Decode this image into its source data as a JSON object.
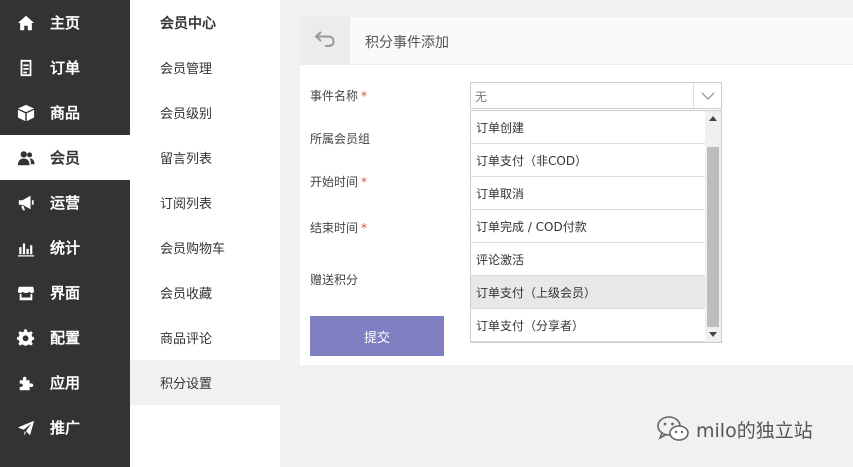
{
  "nav": {
    "items": [
      {
        "label": "主页",
        "icon": "home-icon"
      },
      {
        "label": "订单",
        "icon": "order-document-icon"
      },
      {
        "label": "商品",
        "icon": "box-icon"
      },
      {
        "label": "会员",
        "icon": "users-icon"
      },
      {
        "label": "运营",
        "icon": "megaphone-icon"
      },
      {
        "label": "统计",
        "icon": "bar-chart-icon"
      },
      {
        "label": "界面",
        "icon": "storefront-icon"
      },
      {
        "label": "配置",
        "icon": "gear-icon"
      },
      {
        "label": "应用",
        "icon": "puzzle-icon"
      },
      {
        "label": "推广",
        "icon": "paper-plane-icon"
      }
    ],
    "active_index": 3
  },
  "subnav": {
    "title": "会员中心",
    "items": [
      "会员管理",
      "会员级别",
      "留言列表",
      "订阅列表",
      "会员购物车",
      "会员收藏",
      "商品评论",
      "积分设置"
    ],
    "active_index": 7
  },
  "panel": {
    "title": "积分事件添加",
    "back_icon": "back-arrow-icon"
  },
  "form": {
    "fields": {
      "event_name": {
        "label": "事件名称",
        "required": "*"
      },
      "member_group": {
        "label": "所属会员组"
      },
      "start_time": {
        "label": "开始时间",
        "required": "*"
      },
      "end_time": {
        "label": "结束时间",
        "required": "*"
      },
      "points": {
        "label": "赠送积分"
      }
    },
    "submit_label": "提交",
    "event_select": {
      "value": "无",
      "options": [
        "订单创建",
        "订单支付（非COD）",
        "订单取消",
        "订单完成 / COD付款",
        "评论激活",
        "订单支付（上级会员）",
        "订单支付（分享者）"
      ],
      "hover_index": 5
    }
  },
  "watermark": {
    "text": "milo的独立站"
  },
  "colors": {
    "nav_bg": "#333333",
    "submit_bg": "#7f7fc1",
    "required": "#d9534f",
    "page_bg": "#f1f1f1"
  }
}
